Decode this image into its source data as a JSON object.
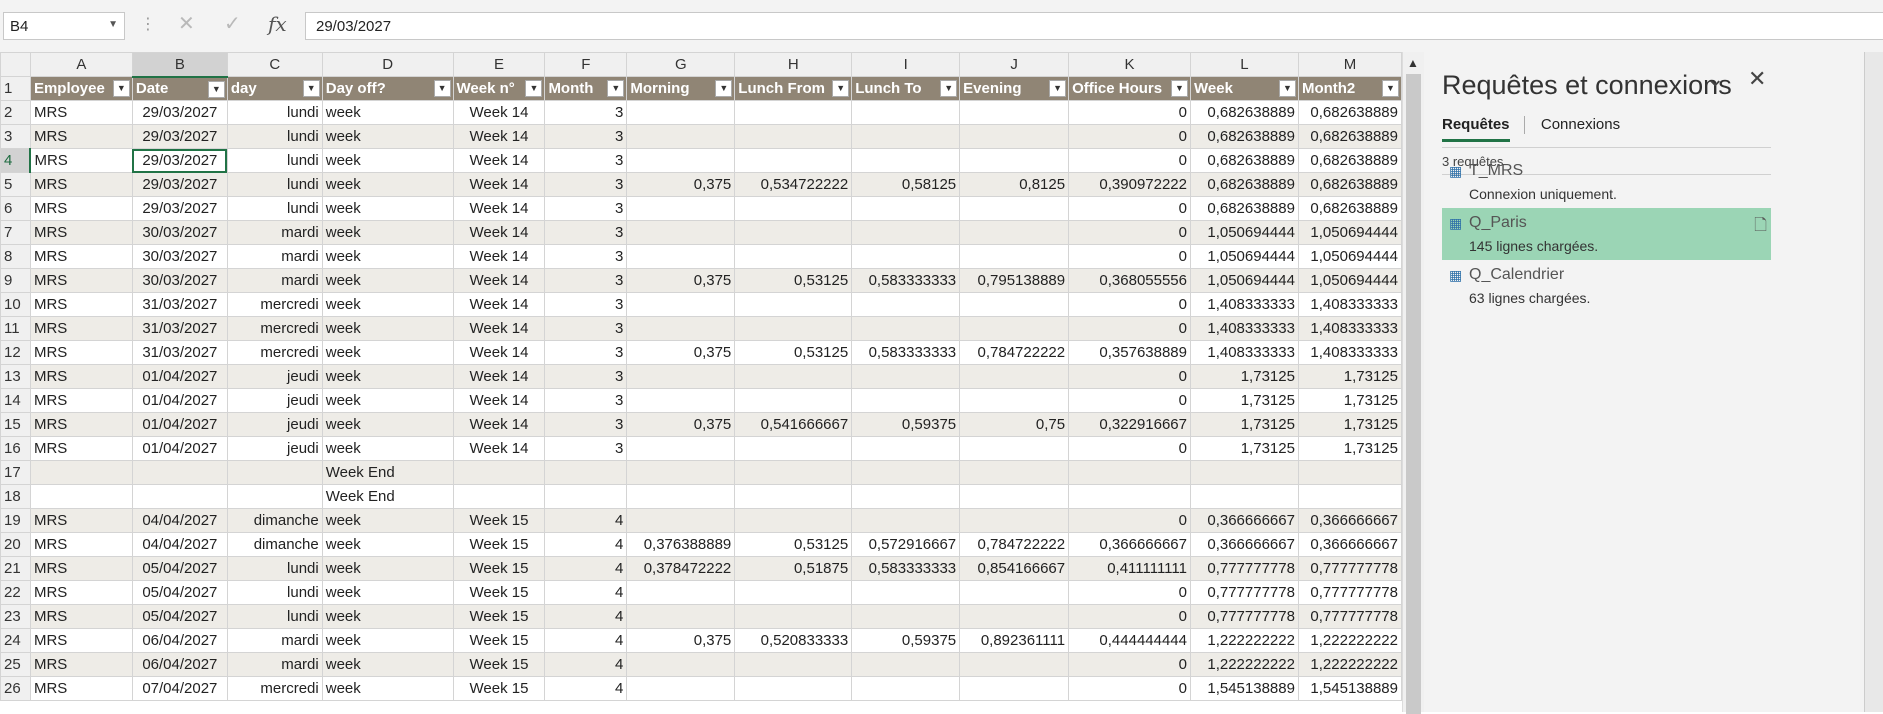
{
  "formula_bar": {
    "name_box": "B4",
    "formula": "29/03/2027"
  },
  "columns": [
    "A",
    "B",
    "C",
    "D",
    "E",
    "F",
    "G",
    "H",
    "I",
    "J",
    "K",
    "L",
    "M"
  ],
  "headers": [
    "Employee",
    "Date",
    "day",
    "Day off?",
    "Week n°",
    "Month",
    "Morning",
    "Lunch From",
    "Lunch To",
    "Evening",
    "Office Hours",
    "Week",
    "Month2"
  ],
  "rows": [
    {
      "n": "2",
      "cells": [
        "MRS",
        "29/03/2027",
        "lundi",
        "week",
        "Week 14",
        "3",
        "",
        "",
        "",
        "",
        "0",
        "0,682638889",
        "0,682638889"
      ]
    },
    {
      "n": "3",
      "cells": [
        "MRS",
        "29/03/2027",
        "lundi",
        "week",
        "Week 14",
        "3",
        "",
        "",
        "",
        "",
        "0",
        "0,682638889",
        "0,682638889"
      ]
    },
    {
      "n": "4",
      "cells": [
        "MRS",
        "29/03/2027",
        "lundi",
        "week",
        "Week 14",
        "3",
        "",
        "",
        "",
        "",
        "0",
        "0,682638889",
        "0,682638889"
      ]
    },
    {
      "n": "5",
      "cells": [
        "MRS",
        "29/03/2027",
        "lundi",
        "week",
        "Week 14",
        "3",
        "0,375",
        "0,534722222",
        "0,58125",
        "0,8125",
        "0,390972222",
        "0,682638889",
        "0,682638889"
      ]
    },
    {
      "n": "6",
      "cells": [
        "MRS",
        "29/03/2027",
        "lundi",
        "week",
        "Week 14",
        "3",
        "",
        "",
        "",
        "",
        "0",
        "0,682638889",
        "0,682638889"
      ]
    },
    {
      "n": "7",
      "cells": [
        "MRS",
        "30/03/2027",
        "mardi",
        "week",
        "Week 14",
        "3",
        "",
        "",
        "",
        "",
        "0",
        "1,050694444",
        "1,050694444"
      ]
    },
    {
      "n": "8",
      "cells": [
        "MRS",
        "30/03/2027",
        "mardi",
        "week",
        "Week 14",
        "3",
        "",
        "",
        "",
        "",
        "0",
        "1,050694444",
        "1,050694444"
      ]
    },
    {
      "n": "9",
      "cells": [
        "MRS",
        "30/03/2027",
        "mardi",
        "week",
        "Week 14",
        "3",
        "0,375",
        "0,53125",
        "0,583333333",
        "0,795138889",
        "0,368055556",
        "1,050694444",
        "1,050694444"
      ]
    },
    {
      "n": "10",
      "cells": [
        "MRS",
        "31/03/2027",
        "mercredi",
        "week",
        "Week 14",
        "3",
        "",
        "",
        "",
        "",
        "0",
        "1,408333333",
        "1,408333333"
      ]
    },
    {
      "n": "11",
      "cells": [
        "MRS",
        "31/03/2027",
        "mercredi",
        "week",
        "Week 14",
        "3",
        "",
        "",
        "",
        "",
        "0",
        "1,408333333",
        "1,408333333"
      ]
    },
    {
      "n": "12",
      "cells": [
        "MRS",
        "31/03/2027",
        "mercredi",
        "week",
        "Week 14",
        "3",
        "0,375",
        "0,53125",
        "0,583333333",
        "0,784722222",
        "0,357638889",
        "1,408333333",
        "1,408333333"
      ]
    },
    {
      "n": "13",
      "cells": [
        "MRS",
        "01/04/2027",
        "jeudi",
        "week",
        "Week 14",
        "3",
        "",
        "",
        "",
        "",
        "0",
        "1,73125",
        "1,73125"
      ]
    },
    {
      "n": "14",
      "cells": [
        "MRS",
        "01/04/2027",
        "jeudi",
        "week",
        "Week 14",
        "3",
        "",
        "",
        "",
        "",
        "0",
        "1,73125",
        "1,73125"
      ]
    },
    {
      "n": "15",
      "cells": [
        "MRS",
        "01/04/2027",
        "jeudi",
        "week",
        "Week 14",
        "3",
        "0,375",
        "0,541666667",
        "0,59375",
        "0,75",
        "0,322916667",
        "1,73125",
        "1,73125"
      ]
    },
    {
      "n": "16",
      "cells": [
        "MRS",
        "01/04/2027",
        "jeudi",
        "week",
        "Week 14",
        "3",
        "",
        "",
        "",
        "",
        "0",
        "1,73125",
        "1,73125"
      ]
    },
    {
      "n": "17",
      "cells": [
        "",
        "",
        "",
        "Week End",
        "",
        "",
        "",
        "",
        "",
        "",
        "",
        "",
        ""
      ]
    },
    {
      "n": "18",
      "cells": [
        "",
        "",
        "",
        "Week End",
        "",
        "",
        "",
        "",
        "",
        "",
        "",
        "",
        ""
      ]
    },
    {
      "n": "19",
      "cells": [
        "MRS",
        "04/04/2027",
        "dimanche",
        "week",
        "Week 15",
        "4",
        "",
        "",
        "",
        "",
        "0",
        "0,366666667",
        "0,366666667"
      ]
    },
    {
      "n": "20",
      "cells": [
        "MRS",
        "04/04/2027",
        "dimanche",
        "week",
        "Week 15",
        "4",
        "0,376388889",
        "0,53125",
        "0,572916667",
        "0,784722222",
        "0,366666667",
        "0,366666667",
        "0,366666667"
      ]
    },
    {
      "n": "21",
      "cells": [
        "MRS",
        "05/04/2027",
        "lundi",
        "week",
        "Week 15",
        "4",
        "0,378472222",
        "0,51875",
        "0,583333333",
        "0,854166667",
        "0,411111111",
        "0,777777778",
        "0,777777778"
      ]
    },
    {
      "n": "22",
      "cells": [
        "MRS",
        "05/04/2027",
        "lundi",
        "week",
        "Week 15",
        "4",
        "",
        "",
        "",
        "",
        "0",
        "0,777777778",
        "0,777777778"
      ]
    },
    {
      "n": "23",
      "cells": [
        "MRS",
        "05/04/2027",
        "lundi",
        "week",
        "Week 15",
        "4",
        "",
        "",
        "",
        "",
        "0",
        "0,777777778",
        "0,777777778"
      ]
    },
    {
      "n": "24",
      "cells": [
        "MRS",
        "06/04/2027",
        "mardi",
        "week",
        "Week 15",
        "4",
        "0,375",
        "0,520833333",
        "0,59375",
        "0,892361111",
        "0,444444444",
        "1,222222222",
        "1,222222222"
      ]
    },
    {
      "n": "25",
      "cells": [
        "MRS",
        "06/04/2027",
        "mardi",
        "week",
        "Week 15",
        "4",
        "",
        "",
        "",
        "",
        "0",
        "1,222222222",
        "1,222222222"
      ]
    },
    {
      "n": "26",
      "cells": [
        "MRS",
        "07/04/2027",
        "mercredi",
        "week",
        "Week 15",
        "4",
        "",
        "",
        "",
        "",
        "0",
        "1,545138889",
        "1,545138889"
      ]
    }
  ],
  "panel": {
    "title": "Requêtes et connexions",
    "tabs": [
      "Requêtes",
      "Connexions"
    ],
    "count": "3 requêtes",
    "queries": [
      {
        "name": "T_MRS",
        "status": "Connexion uniquement.",
        "selected": false
      },
      {
        "name": "Q_Paris",
        "status": "145 lignes chargées.",
        "selected": true
      },
      {
        "name": "Q_Calendrier",
        "status": "63 lignes chargées.",
        "selected": false
      }
    ]
  },
  "colors": {
    "header_bg": "#908575",
    "band": "#eeece7",
    "accent": "#217346",
    "selected_query": "#9bd5b5"
  }
}
